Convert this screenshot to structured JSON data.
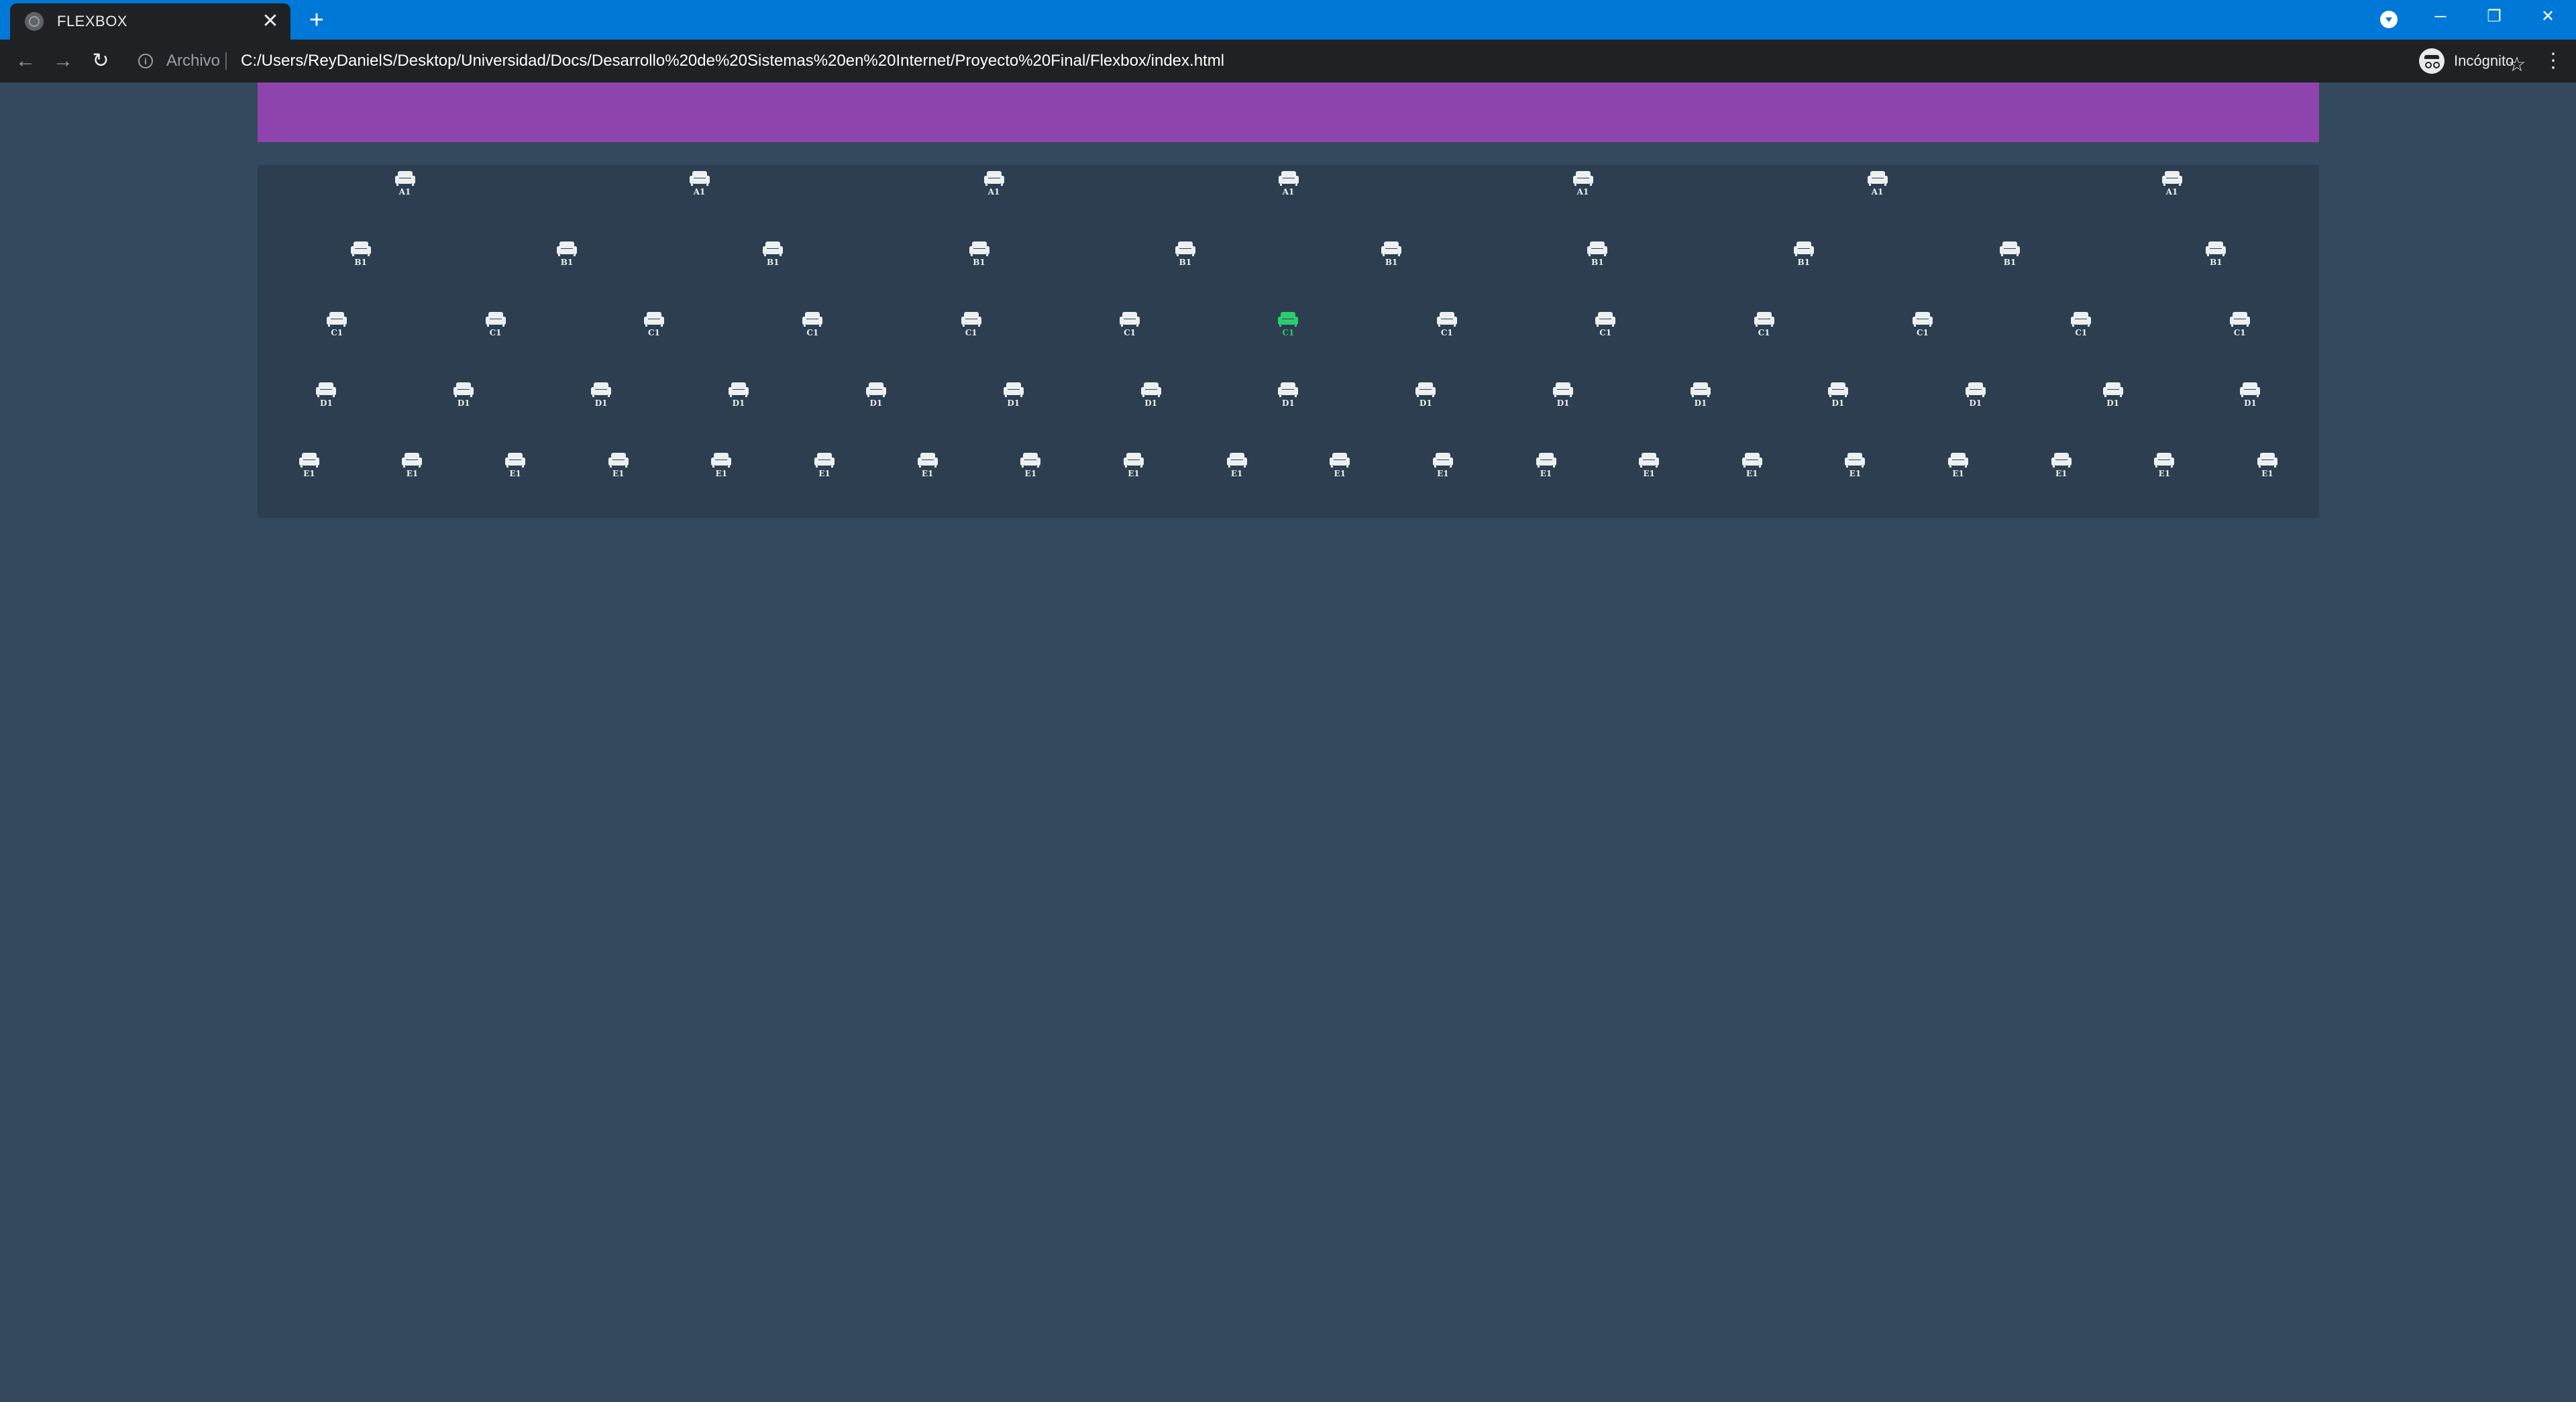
{
  "browser": {
    "tab_title": "FLEXBOX",
    "tab_close": "✕",
    "new_tab": "+",
    "url_scheme_label": "Archivo",
    "url": "C:/Users/ReyDanielS/Desktop/Universidad/Docs/Desarrollo%20de%20Sistemas%20en%20Internet/Proyecto%20Final/Flexbox/index.html",
    "profile_label": "Incógnito",
    "nav": {
      "back": "←",
      "forward": "→",
      "reload": "↻"
    },
    "star": "☆",
    "menu": "⋮",
    "window_controls": {
      "minimize": "─",
      "restore": "❐",
      "close": "✕"
    }
  },
  "colors": {
    "page_background": "#34495e",
    "screen": "#8e44ad",
    "hall": "#2c3e50",
    "seat": "#ecf0f1",
    "seat_selected": "#2ecc71",
    "tabbar": "#0078d7"
  },
  "seat_icon": "couch-icon",
  "rows": [
    {
      "seats": [
        "A1",
        "A1",
        "A1",
        "A1",
        "A1",
        "A1",
        "A1"
      ]
    },
    {
      "seats": [
        "B1",
        "B1",
        "B1",
        "B1",
        "B1",
        "B1",
        "B1",
        "B1",
        "B1",
        "B1"
      ]
    },
    {
      "seats": [
        "C1",
        "C1",
        "C1",
        "C1",
        "C1",
        "C1",
        "C1",
        "C1",
        "C1",
        "C1",
        "C1",
        "C1",
        "C1"
      ],
      "selected_index": 6
    },
    {
      "seats": [
        "D1",
        "D1",
        "D1",
        "D1",
        "D1",
        "D1",
        "D1",
        "D1",
        "D1",
        "D1",
        "D1",
        "D1",
        "D1",
        "D1",
        "D1"
      ]
    },
    {
      "seats": [
        "E1",
        "E1",
        "E1",
        "E1",
        "E1",
        "E1",
        "E1",
        "E1",
        "E1",
        "E1",
        "E1",
        "E1",
        "E1",
        "E1",
        "E1",
        "E1",
        "E1",
        "E1",
        "E1",
        "E1"
      ]
    }
  ]
}
